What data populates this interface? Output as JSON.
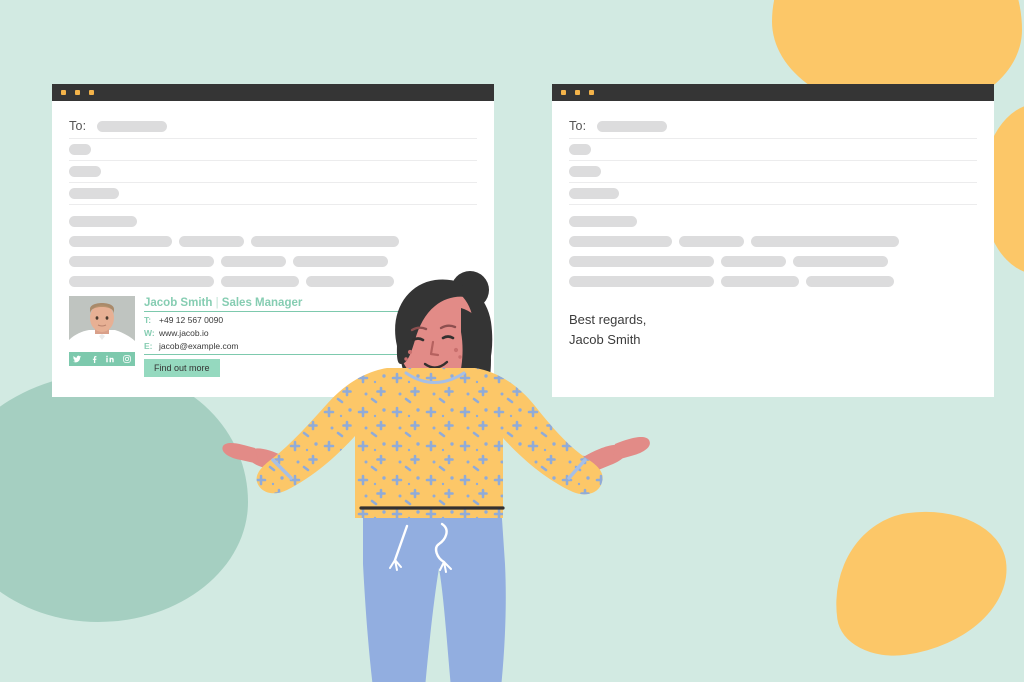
{
  "theme": {
    "background": "#d2eae2",
    "accent_green": "#7dc9ad",
    "accent_green_light": "#95d9bf",
    "accent_yellow": "#fcc768",
    "blob_green": "#a5cfc1",
    "titlebar": "#353535",
    "dot": "#f3b34a",
    "placeholder": "#dcdcdd",
    "sweater": "#fcc768",
    "pants": "#92aee0",
    "skin": "#e28b87",
    "hair": "#343434"
  },
  "windows": {
    "left": {
      "name": "email-with-signature",
      "titlebar_dots": [
        "dot-1",
        "dot-2",
        "dot-3"
      ],
      "to_label": "To:",
      "signature": {
        "name": "Jacob Smith",
        "separator": "|",
        "title": "Sales Manager",
        "rows": [
          {
            "key": "T:",
            "value": "+49 12 567 0090"
          },
          {
            "key": "W:",
            "value": "www.jacob.io"
          },
          {
            "key": "E:",
            "value": "jacob@example.com"
          }
        ],
        "cta_label": "Find out more",
        "social": [
          "twitter-icon",
          "facebook-icon",
          "linkedin-icon",
          "instagram-icon"
        ],
        "photo_alt": "headshot-photo"
      }
    },
    "right": {
      "name": "email-plain-text",
      "titlebar_dots": [
        "dot-1",
        "dot-2",
        "dot-3"
      ],
      "to_label": "To:",
      "closing_line_1": "Best regards,",
      "closing_line_2": "Jacob Smith"
    }
  },
  "placeholders": {
    "to_value_width": 70,
    "header_rows": [
      22,
      32,
      50
    ],
    "subject_width": 68,
    "body_lines": [
      [
        103,
        65,
        148
      ],
      [
        145,
        65,
        95
      ],
      [
        145,
        78,
        88
      ]
    ]
  },
  "character": {
    "name": "shrugging-woman-illustration",
    "description": "Woman with dark hair in a bun wearing a yellow patterned sweater and blue trousers, arms open in a shrug"
  }
}
